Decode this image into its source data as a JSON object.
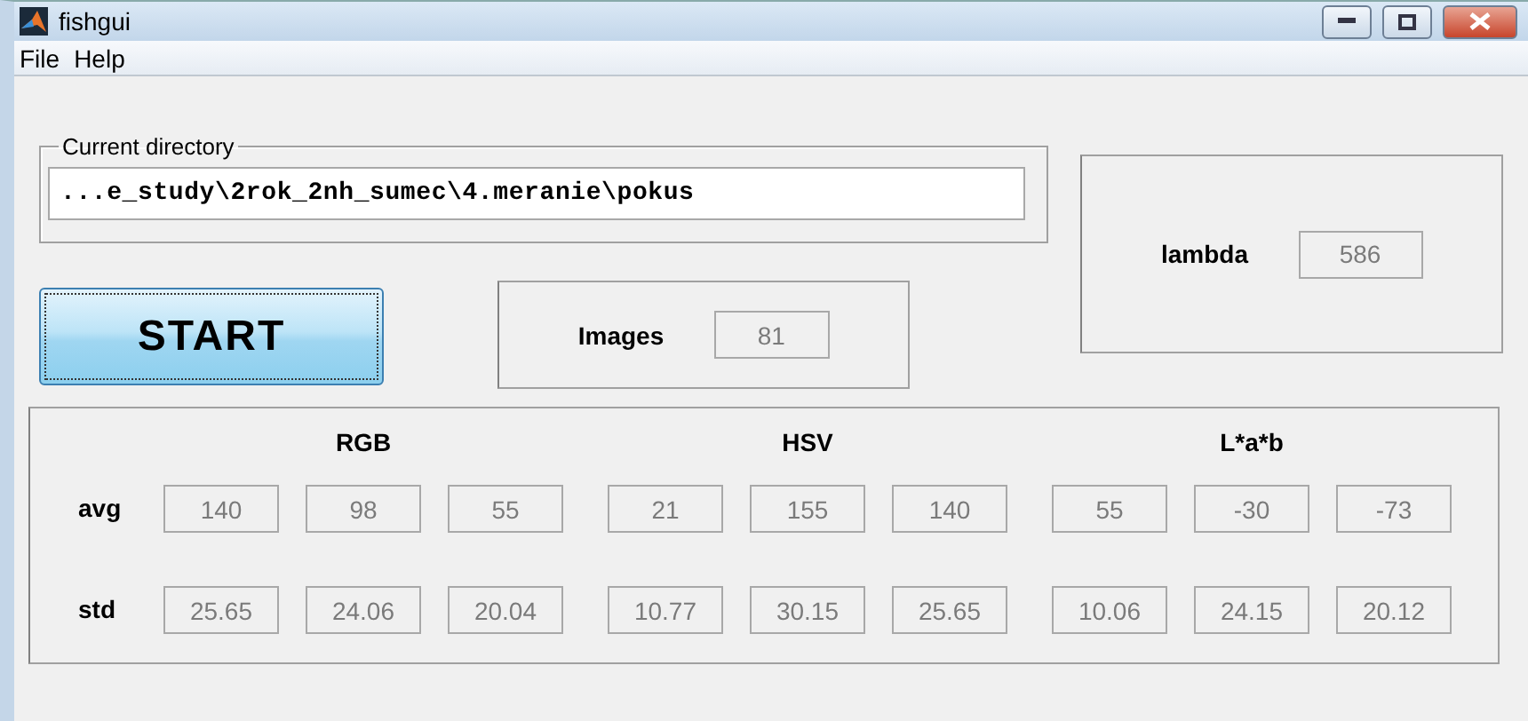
{
  "window": {
    "title": "fishgui"
  },
  "menu": [
    "File",
    "Help"
  ],
  "directory": {
    "label": "Current directory",
    "value": "...e_study\\2rok_2nh_sumec\\4.meranie\\pokus"
  },
  "start_button": "START",
  "images": {
    "label": "Images",
    "value": "81"
  },
  "lambda": {
    "label": "lambda",
    "value": "586"
  },
  "table": {
    "groups": [
      "RGB",
      "HSV",
      "L*a*b"
    ],
    "rows": [
      {
        "label": "avg",
        "values": [
          "140",
          "98",
          "55",
          "21",
          "155",
          "140",
          "55",
          "-30",
          "-73"
        ]
      },
      {
        "label": "std",
        "values": [
          "25.65",
          "24.06",
          "20.04",
          "10.77",
          "30.15",
          "25.65",
          "10.06",
          "24.15",
          "20.12"
        ]
      }
    ]
  }
}
